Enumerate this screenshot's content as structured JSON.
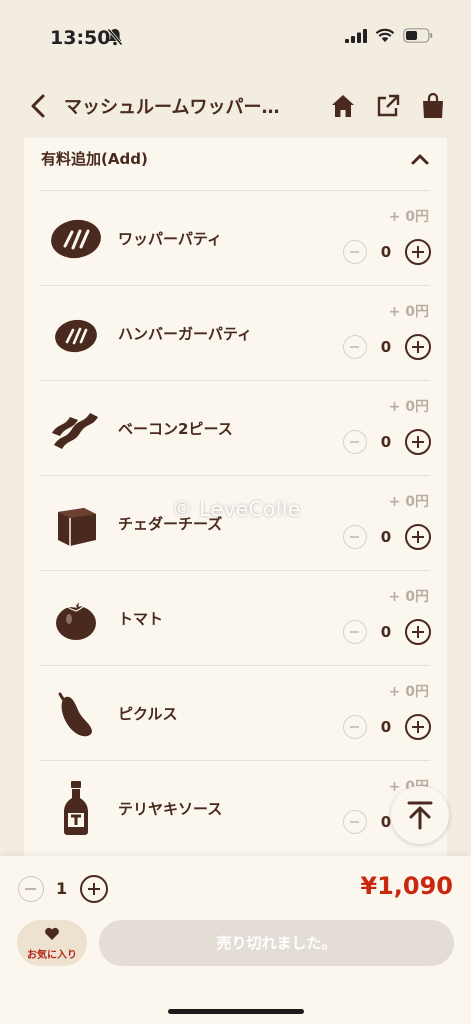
{
  "status_bar": {
    "time": "13:50"
  },
  "nav": {
    "title": "マッシュルームワッパー…"
  },
  "section": {
    "title": "有料追加(Add)"
  },
  "items": [
    {
      "name": "ワッパーパティ",
      "price": "+ 0円",
      "qty": "0",
      "icon": "patty-icon"
    },
    {
      "name": "ハンバーガーパティ",
      "price": "+ 0円",
      "qty": "0",
      "icon": "small-patty-icon"
    },
    {
      "name": "ベーコン2ピース",
      "price": "+ 0円",
      "qty": "0",
      "icon": "bacon-icon"
    },
    {
      "name": "チェダーチーズ",
      "price": "+ 0円",
      "qty": "0",
      "icon": "cheese-icon"
    },
    {
      "name": "トマト",
      "price": "+ 0円",
      "qty": "0",
      "icon": "tomato-icon"
    },
    {
      "name": "ピクルス",
      "price": "+ 0円",
      "qty": "0",
      "icon": "pickle-icon"
    },
    {
      "name": "テリヤキソース",
      "price": "+ 0円",
      "qty": "0",
      "icon": "sauce-bottle-icon"
    }
  ],
  "watermark": "© LeveColle",
  "footer": {
    "qty": "1",
    "price": "¥1,090",
    "favorite_label": "お気に入り",
    "soldout_label": "売り切れました。"
  },
  "colors": {
    "brand_brown": "#4a2a1e",
    "price_red": "#c8280f",
    "background": "#f3ece1"
  }
}
